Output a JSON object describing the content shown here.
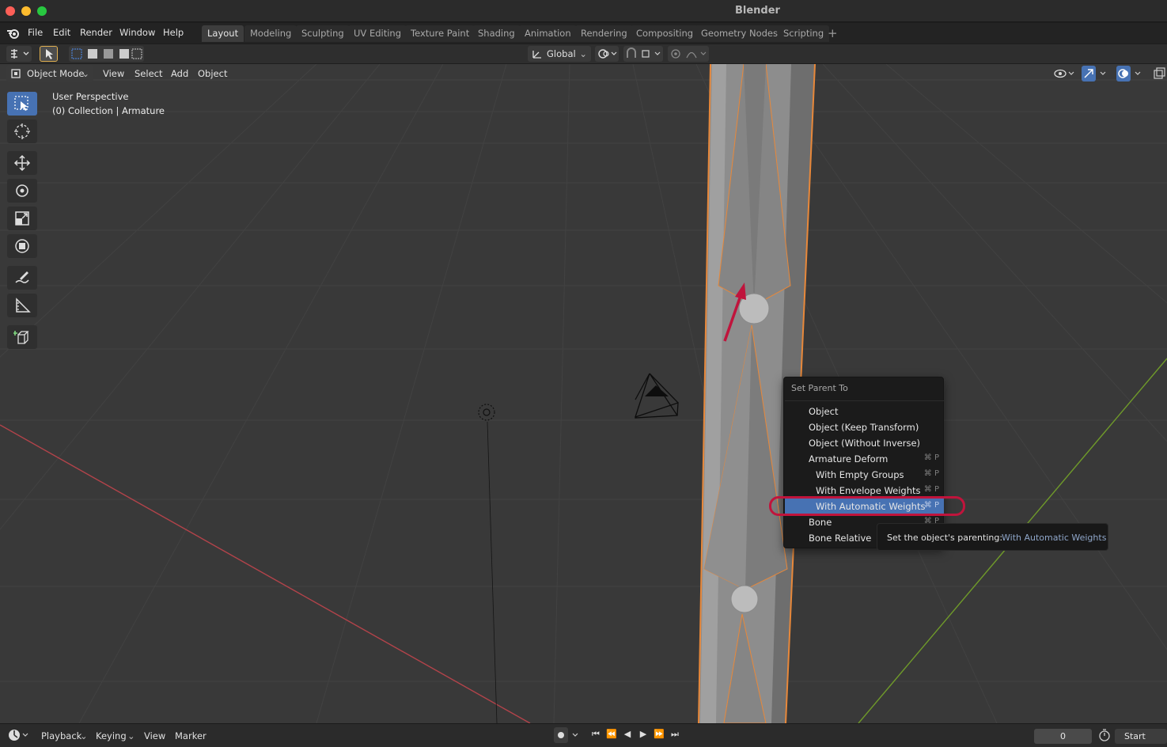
{
  "window": {
    "title": "Blender"
  },
  "menubar": {
    "items": [
      "File",
      "Edit",
      "Render",
      "Window",
      "Help"
    ],
    "workspaces": [
      "Layout",
      "Modeling",
      "Sculpting",
      "UV Editing",
      "Texture Paint",
      "Shading",
      "Animation",
      "Rendering",
      "Compositing",
      "Geometry Nodes",
      "Scripting"
    ],
    "active_workspace": "Layout",
    "add_tab_symbol": "+"
  },
  "tool_header": {
    "orientation": "Global"
  },
  "viewport_header": {
    "mode": "Object Mode",
    "menus": [
      "View",
      "Select",
      "Add",
      "Object"
    ]
  },
  "viewport": {
    "perspective_label": "User Perspective",
    "collection_label": "(0) Collection | Armature"
  },
  "context_menu": {
    "title": "Set Parent To",
    "items": [
      {
        "label": "Object",
        "shortcut": "",
        "indent": false,
        "highlighted": false
      },
      {
        "label": "Object (Keep Transform)",
        "shortcut": "",
        "indent": false,
        "highlighted": false
      },
      {
        "label": "Object (Without Inverse)",
        "shortcut": "",
        "indent": false,
        "highlighted": false
      },
      {
        "label": "Armature Deform",
        "shortcut": "⌘ P",
        "indent": false,
        "highlighted": false
      },
      {
        "label": "With Empty Groups",
        "shortcut": "⌘ P",
        "indent": true,
        "highlighted": false
      },
      {
        "label": "With Envelope Weights",
        "shortcut": "⌘ P",
        "indent": true,
        "highlighted": false
      },
      {
        "label": "With Automatic Weights",
        "shortcut": "⌘ P",
        "indent": true,
        "highlighted": true
      },
      {
        "label": "Bone",
        "shortcut": "⌘ P",
        "indent": false,
        "highlighted": false
      },
      {
        "label": "Bone Relative",
        "shortcut": "",
        "indent": false,
        "highlighted": false
      }
    ]
  },
  "tooltip": {
    "text": "Set the object's parenting:",
    "value": "With Automatic Weights"
  },
  "timeline": {
    "menus": [
      "Playback",
      "Keying",
      "View",
      "Marker"
    ],
    "current_frame": "0",
    "start_label": "Start"
  },
  "colors": {
    "accent": "#4772b3",
    "annotation": "#c0143c",
    "selection_outline": "#e8883a"
  }
}
